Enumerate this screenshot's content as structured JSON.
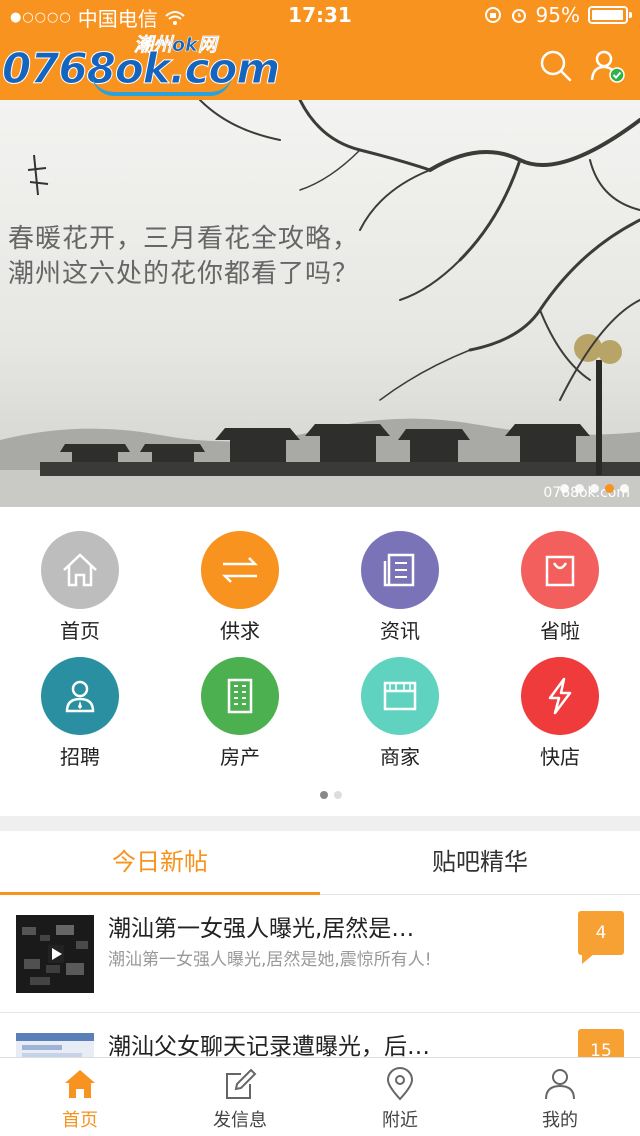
{
  "status_bar": {
    "carrier": "中国电信",
    "time": "17:31",
    "battery": "95%"
  },
  "header": {
    "logo_sub": "潮州ok网",
    "logo_main": "0768ok.com",
    "icons": [
      "search-icon",
      "user-verified-icon"
    ]
  },
  "banner": {
    "caption_line1": "春暖花开，三月看花全攻略，",
    "caption_line2": "潮州这六处的花你都看了吗？",
    "watermark": "0768ok.com",
    "slide_count": 5,
    "active_slide": 4
  },
  "categories": [
    {
      "label": "首页",
      "icon": "home-icon",
      "color": "#bdbdbd"
    },
    {
      "label": "供求",
      "icon": "exchange-icon",
      "color": "#f7931e"
    },
    {
      "label": "资讯",
      "icon": "news-icon",
      "color": "#7b73b8"
    },
    {
      "label": "省啦",
      "icon": "shopping-bag-icon",
      "color": "#f25f5c"
    },
    {
      "label": "招聘",
      "icon": "person-icon",
      "color": "#2a8fa0"
    },
    {
      "label": "房产",
      "icon": "building-icon",
      "color": "#4caf50"
    },
    {
      "label": "商家",
      "icon": "store-icon",
      "color": "#5fd3c0"
    },
    {
      "label": "快店",
      "icon": "lightning-icon",
      "color": "#ef3b3b"
    }
  ],
  "category_pages": {
    "count": 2,
    "active": 1
  },
  "tabs": [
    {
      "label": "今日新帖",
      "active": true
    },
    {
      "label": "贴吧精华",
      "active": false
    }
  ],
  "posts": [
    {
      "title": "潮汕第一女强人曝光,居然是…",
      "summary": "潮汕第一女强人曝光,居然是她,震惊所有人!",
      "comments": "4"
    },
    {
      "title": "潮汕父女聊天记录遭曝光，后…",
      "summary": "",
      "comments": "15"
    }
  ],
  "bottom_nav": [
    {
      "label": "首页",
      "icon": "home-icon",
      "active": true
    },
    {
      "label": "发信息",
      "icon": "edit-icon",
      "active": false
    },
    {
      "label": "附近",
      "icon": "location-icon",
      "active": false
    },
    {
      "label": "我的",
      "icon": "profile-icon",
      "active": false
    }
  ]
}
